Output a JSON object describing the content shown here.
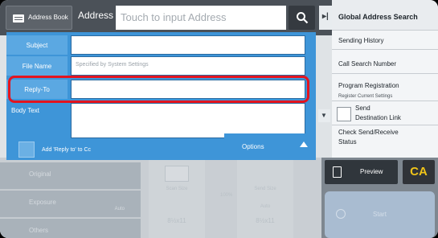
{
  "topbar": {
    "address_book_label": "Address Book",
    "address_label": "Address",
    "address_placeholder": "Touch to input Address"
  },
  "form": {
    "subject_label": "Subject",
    "subject_value": "",
    "file_name_label": "File Name",
    "file_name_placeholder": "Specified by System Settings",
    "reply_to_label": "Reply-To",
    "reply_to_value": "",
    "body_text_label": "Body Text",
    "body_text_value": "",
    "add_reply_cc_label": "Add 'Reply to' to Cc",
    "options_label": "Options"
  },
  "side_panel": {
    "items": [
      {
        "label": "Global Address Search"
      },
      {
        "label": "Sending History"
      },
      {
        "label": "Call Search Number"
      },
      {
        "label": "Program Registration",
        "sub": "Register Current Settings"
      },
      {
        "label": "Send",
        "label2": "Destination Link"
      },
      {
        "label": "Check Send/Receive",
        "label2": "Status"
      }
    ]
  },
  "actions": {
    "preview_label": "Preview",
    "ca_label": "CA",
    "start_label": "Start"
  },
  "background": {
    "rows": [
      {
        "label": "Original",
        "sub": ""
      },
      {
        "label": "Exposure",
        "sub": "Auto"
      },
      {
        "label": "Others",
        "sub": ""
      }
    ],
    "scan_size_label": "Scan Size",
    "send_size_label": "Send Size",
    "scan_size_value": "8½x11",
    "send_size_value": "8½x11",
    "send_size_sub": "Auto",
    "ratio": "100%"
  },
  "colors": {
    "panel_blue": "#3e95d8",
    "highlight_red": "#e3141f",
    "ca_yellow": "#f0c419",
    "topbar": "#4b5158"
  }
}
